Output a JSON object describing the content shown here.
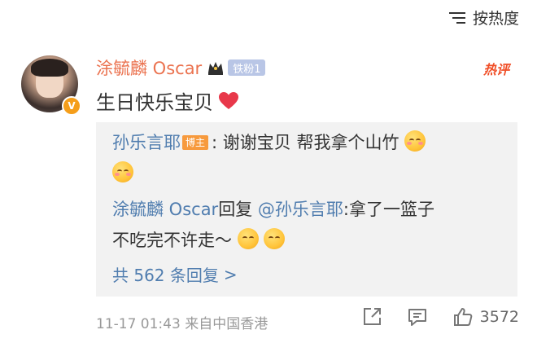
{
  "sort": {
    "label": "按热度",
    "icon": "sort-icon"
  },
  "comment": {
    "username": "涂毓麟 Oscar",
    "fan_badge": "铁粉1",
    "hot_tag": "热评",
    "text": "生日快乐宝贝",
    "timestamp": "11-17 01:43",
    "location": "来自中国香港",
    "like_count": "3572"
  },
  "replies": [
    {
      "author": "孙乐言耶",
      "author_badge": "博主",
      "text": ": 谢谢宝贝 帮我拿个山竹"
    },
    {
      "author": "涂毓麟 Oscar",
      "reply_word": "回复",
      "mention": "@孙乐言耶",
      "text_line1": ":拿了一篮子",
      "text_line2": "不吃完不许走～"
    }
  ],
  "more_replies": {
    "label": "共 562 条回复",
    "chevron": ">"
  },
  "colors": {
    "username": "#eb7350",
    "link": "#507daf",
    "hot_tag": "#f04f28",
    "reply_bg": "#f2f2f2",
    "muted": "#999999"
  }
}
